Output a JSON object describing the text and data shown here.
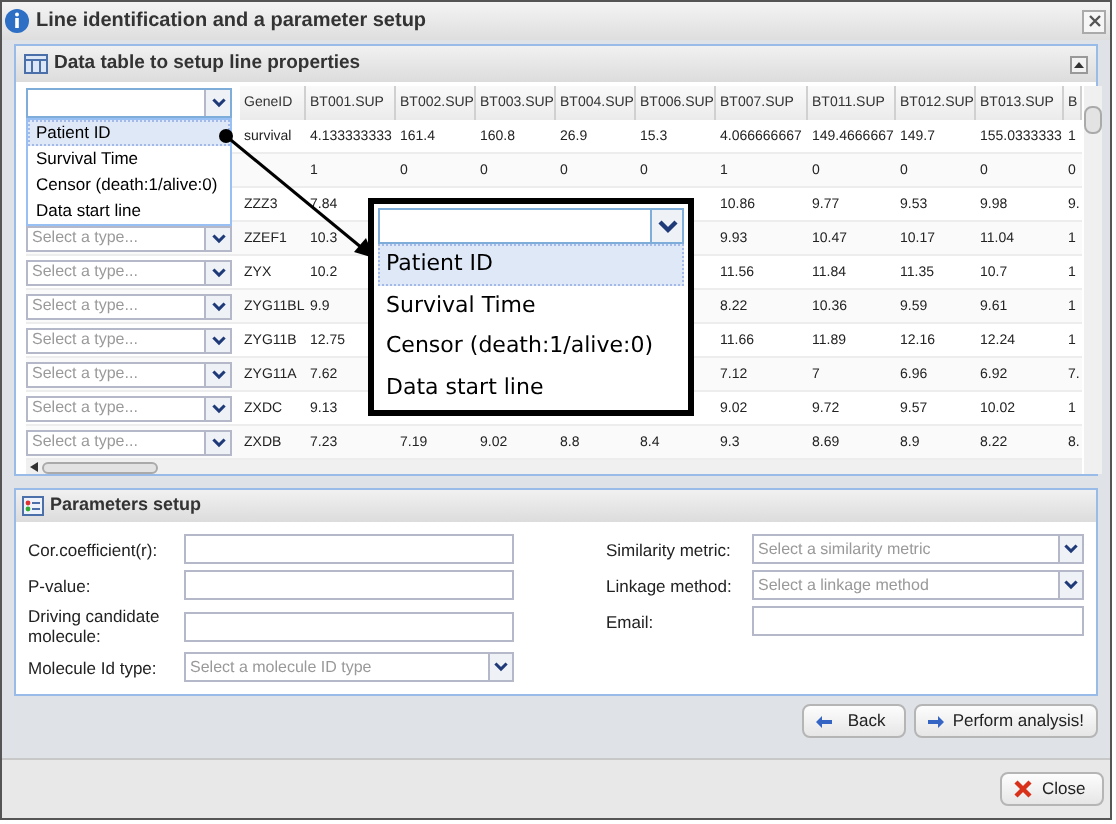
{
  "window": {
    "title": "Line identification and a parameter setup"
  },
  "data_panel": {
    "title": "Data table to setup line properties"
  },
  "table": {
    "header_select": {
      "expanded": true,
      "options": [
        {
          "label": "Patient ID",
          "selected": true
        },
        {
          "label": "Survival Time",
          "selected": false
        },
        {
          "label": "Censor (death:1/alive:0)",
          "selected": false
        },
        {
          "label": "Data start line",
          "selected": false
        }
      ]
    },
    "columns": [
      "GeneID",
      "BT001.SUP",
      "BT002.SUP",
      "BT003.SUP",
      "BT004.SUP",
      "BT006.SUP",
      "BT007.SUP",
      "BT011.SUP",
      "BT012.SUP",
      "BT013.SUP",
      "B"
    ],
    "rows": [
      {
        "cells": [
          "survival",
          "4.133333333",
          "161.4",
          "160.8",
          "26.9",
          "15.3",
          "4.066666667",
          "149.4666667",
          "149.7",
          "155.0333333",
          "1"
        ]
      },
      {
        "cells": [
          null,
          "1",
          "0",
          "0",
          "0",
          "0",
          "1",
          "0",
          "0",
          "0",
          "0"
        ]
      },
      {
        "cells": [
          "ZZZ3",
          "7.84",
          null,
          null,
          null,
          null,
          "10.86",
          "9.77",
          "9.53",
          "9.98",
          "9."
        ]
      },
      {
        "placeholder": "Select a type...",
        "cells": [
          "ZZEF1",
          "10.3",
          null,
          null,
          null,
          null,
          "9.93",
          "10.47",
          "10.17",
          "11.04",
          "1"
        ]
      },
      {
        "placeholder": "Select a type...",
        "cells": [
          "ZYX",
          "10.2",
          null,
          null,
          null,
          null,
          "11.56",
          "11.84",
          "11.35",
          "10.7",
          "1"
        ]
      },
      {
        "placeholder": "Select a type...",
        "cells": [
          "ZYG11BL",
          "9.9",
          null,
          null,
          null,
          null,
          "8.22",
          "10.36",
          "9.59",
          "9.61",
          "1"
        ]
      },
      {
        "placeholder": "Select a type...",
        "cells": [
          "ZYG11B",
          "12.75",
          null,
          null,
          null,
          null,
          "11.66",
          "11.89",
          "12.16",
          "12.24",
          "1"
        ]
      },
      {
        "placeholder": "Select a type...",
        "cells": [
          "ZYG11A",
          "7.62",
          null,
          null,
          null,
          null,
          "7.12",
          "7",
          "6.96",
          "6.92",
          "7."
        ]
      },
      {
        "placeholder": "Select a type...",
        "cells": [
          "ZXDC",
          "9.13",
          null,
          null,
          null,
          null,
          "9.02",
          "9.72",
          "9.57",
          "10.02",
          "1"
        ]
      },
      {
        "placeholder": "Select a type...",
        "cells": [
          "ZXDB",
          "7.23",
          "7.19",
          "9.02",
          "8.8",
          "8.4",
          "9.3",
          "8.69",
          "8.9",
          "8.22",
          "8."
        ]
      }
    ]
  },
  "zoom_inset": {
    "options": [
      {
        "label": "Patient ID",
        "selected": true
      },
      {
        "label": "Survival Time",
        "selected": false
      },
      {
        "label": "Censor (death:1/alive:0)",
        "selected": false
      },
      {
        "label": "Data start line",
        "selected": false
      }
    ]
  },
  "parameters_panel": {
    "title": "Parameters setup",
    "left_fields": [
      {
        "label": "Cor.coefficient(r):",
        "kind": "text"
      },
      {
        "label": "P-value:",
        "kind": "text"
      },
      {
        "label": "Driving candidate molecule:",
        "kind": "text"
      },
      {
        "label": "Molecule Id type:",
        "kind": "select",
        "placeholder": "Select a molecule ID type"
      }
    ],
    "right_fields": [
      {
        "label": "Similarity metric:",
        "kind": "select",
        "placeholder": "Select a similarity metric"
      },
      {
        "label": "Linkage method:",
        "kind": "select",
        "placeholder": "Select a linkage method"
      },
      {
        "label": "Email:",
        "kind": "text"
      }
    ]
  },
  "buttons": [
    {
      "label": "Back",
      "kind": "back"
    },
    {
      "label": "Perform analysis!",
      "kind": "forward"
    }
  ],
  "close_button": {
    "label": "Close"
  }
}
